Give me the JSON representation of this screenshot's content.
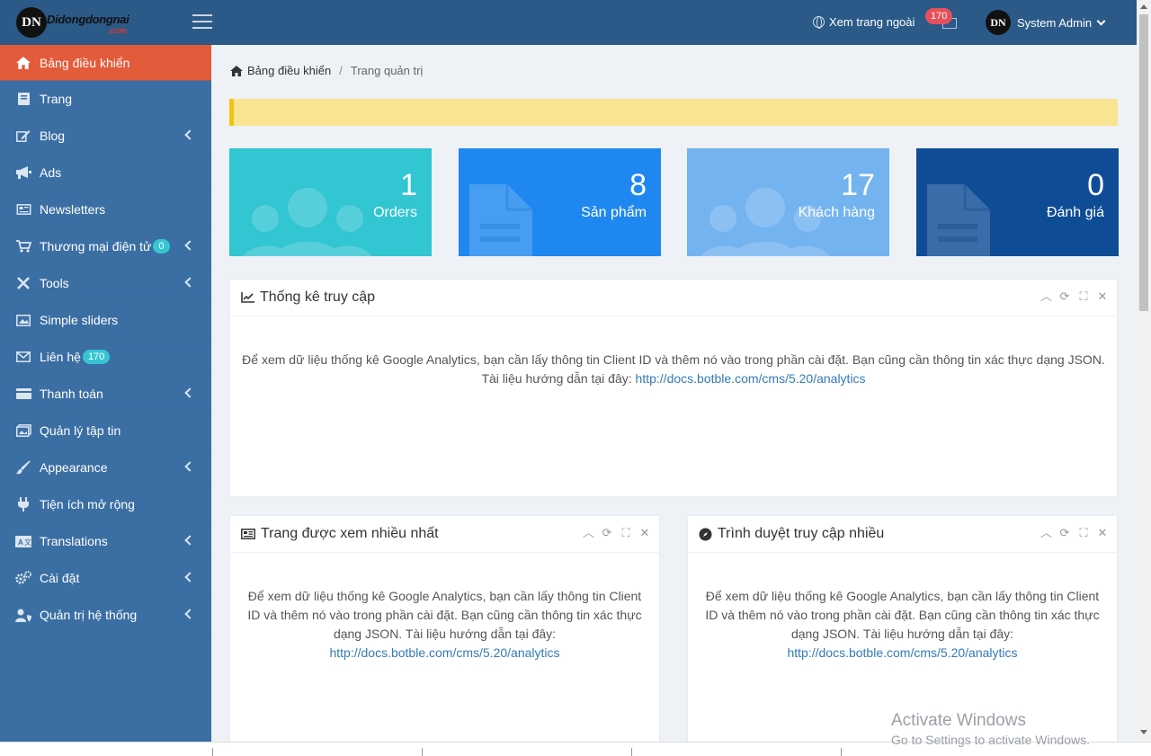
{
  "header": {
    "logo_mark": "DN",
    "logo_text": "Didongdongnai",
    "logo_suffix": ".com",
    "view_site_label": "Xem trang ngoài",
    "mail_count": "170",
    "user_name": "System Admin"
  },
  "sidebar": {
    "items": [
      {
        "label": "Bảng điều khiển",
        "icon": "home-icon",
        "active": true,
        "has_children": false
      },
      {
        "label": "Trang",
        "icon": "book-icon",
        "has_children": false
      },
      {
        "label": "Blog",
        "icon": "edit-icon",
        "has_children": true
      },
      {
        "label": "Ads",
        "icon": "bullhorn-icon",
        "has_children": false
      },
      {
        "label": "Newsletters",
        "icon": "newspaper-icon",
        "has_children": false
      },
      {
        "label": "Thương mại điện tử",
        "icon": "cart-icon",
        "badge": "0",
        "has_children": true
      },
      {
        "label": "Tools",
        "icon": "tools-icon",
        "has_children": true
      },
      {
        "label": "Simple sliders",
        "icon": "image-icon",
        "has_children": false
      },
      {
        "label": "Liên hệ",
        "icon": "envelope-icon",
        "badge": "170",
        "has_children": false
      },
      {
        "label": "Thanh toán",
        "icon": "credit-card-icon",
        "has_children": true
      },
      {
        "label": "Quản lý tập tin",
        "icon": "images-icon",
        "has_children": false
      },
      {
        "label": "Appearance",
        "icon": "paintbrush-icon",
        "has_children": true
      },
      {
        "label": "Tiện ích mở rộng",
        "icon": "plug-icon",
        "has_children": false
      },
      {
        "label": "Translations",
        "icon": "language-icon",
        "has_children": true
      },
      {
        "label": "Cài đặt",
        "icon": "cogs-icon",
        "has_children": true
      },
      {
        "label": "Quản trị hệ thống",
        "icon": "user-shield-icon",
        "has_children": true
      }
    ]
  },
  "breadcrumb": {
    "home": "Bảng điều khiển",
    "current": "Trang quản trị"
  },
  "stats": [
    {
      "value": "1",
      "label": "Orders",
      "color": "#32c5d2",
      "icon": "users-icon"
    },
    {
      "value": "8",
      "label": "Sản phẩm",
      "color": "#1e88f0",
      "icon": "file-icon"
    },
    {
      "value": "17",
      "label": "Khách hàng",
      "color": "#73b3f0",
      "icon": "users-icon"
    },
    {
      "value": "0",
      "label": "Đánh giá",
      "color": "#0e4c96",
      "icon": "file-icon"
    }
  ],
  "panels": {
    "traffic": {
      "title": "Thống kê truy cập",
      "body": "Để xem dữ liệu thống kê Google Analytics, bạn cần lấy thông tin Client ID và thêm nó vào trong phần cài đặt. Bạn cũng cần thông tin xác thực dạng JSON. Tài liệu hướng dẫn tại đây:",
      "link": "http://docs.botble.com/cms/5.20/analytics"
    },
    "top_pages": {
      "title": "Trang được xem nhiều nhất",
      "body": "Để xem dữ liệu thống kê Google Analytics, bạn cần lấy thông tin Client ID và thêm nó vào trong phần cài đặt. Bạn cũng cần thông tin xác thực dạng JSON. Tài liệu hướng dẫn tại đây:",
      "link": "http://docs.botble.com/cms/5.20/analytics"
    },
    "top_browsers": {
      "title": "Trình duyệt truy cập nhiều",
      "body": "Để xem dữ liệu thống kê Google Analytics, bạn cần lấy thông tin Client ID và thêm nó vào trong phần cài đặt. Bạn cũng cần thông tin xác thực dạng JSON. Tài liệu hướng dẫn tại đây:",
      "link": "http://docs.botble.com/cms/5.20/analytics"
    }
  },
  "watermark": {
    "line1": "Activate Windows",
    "line2": "Go to Settings to activate Windows."
  }
}
